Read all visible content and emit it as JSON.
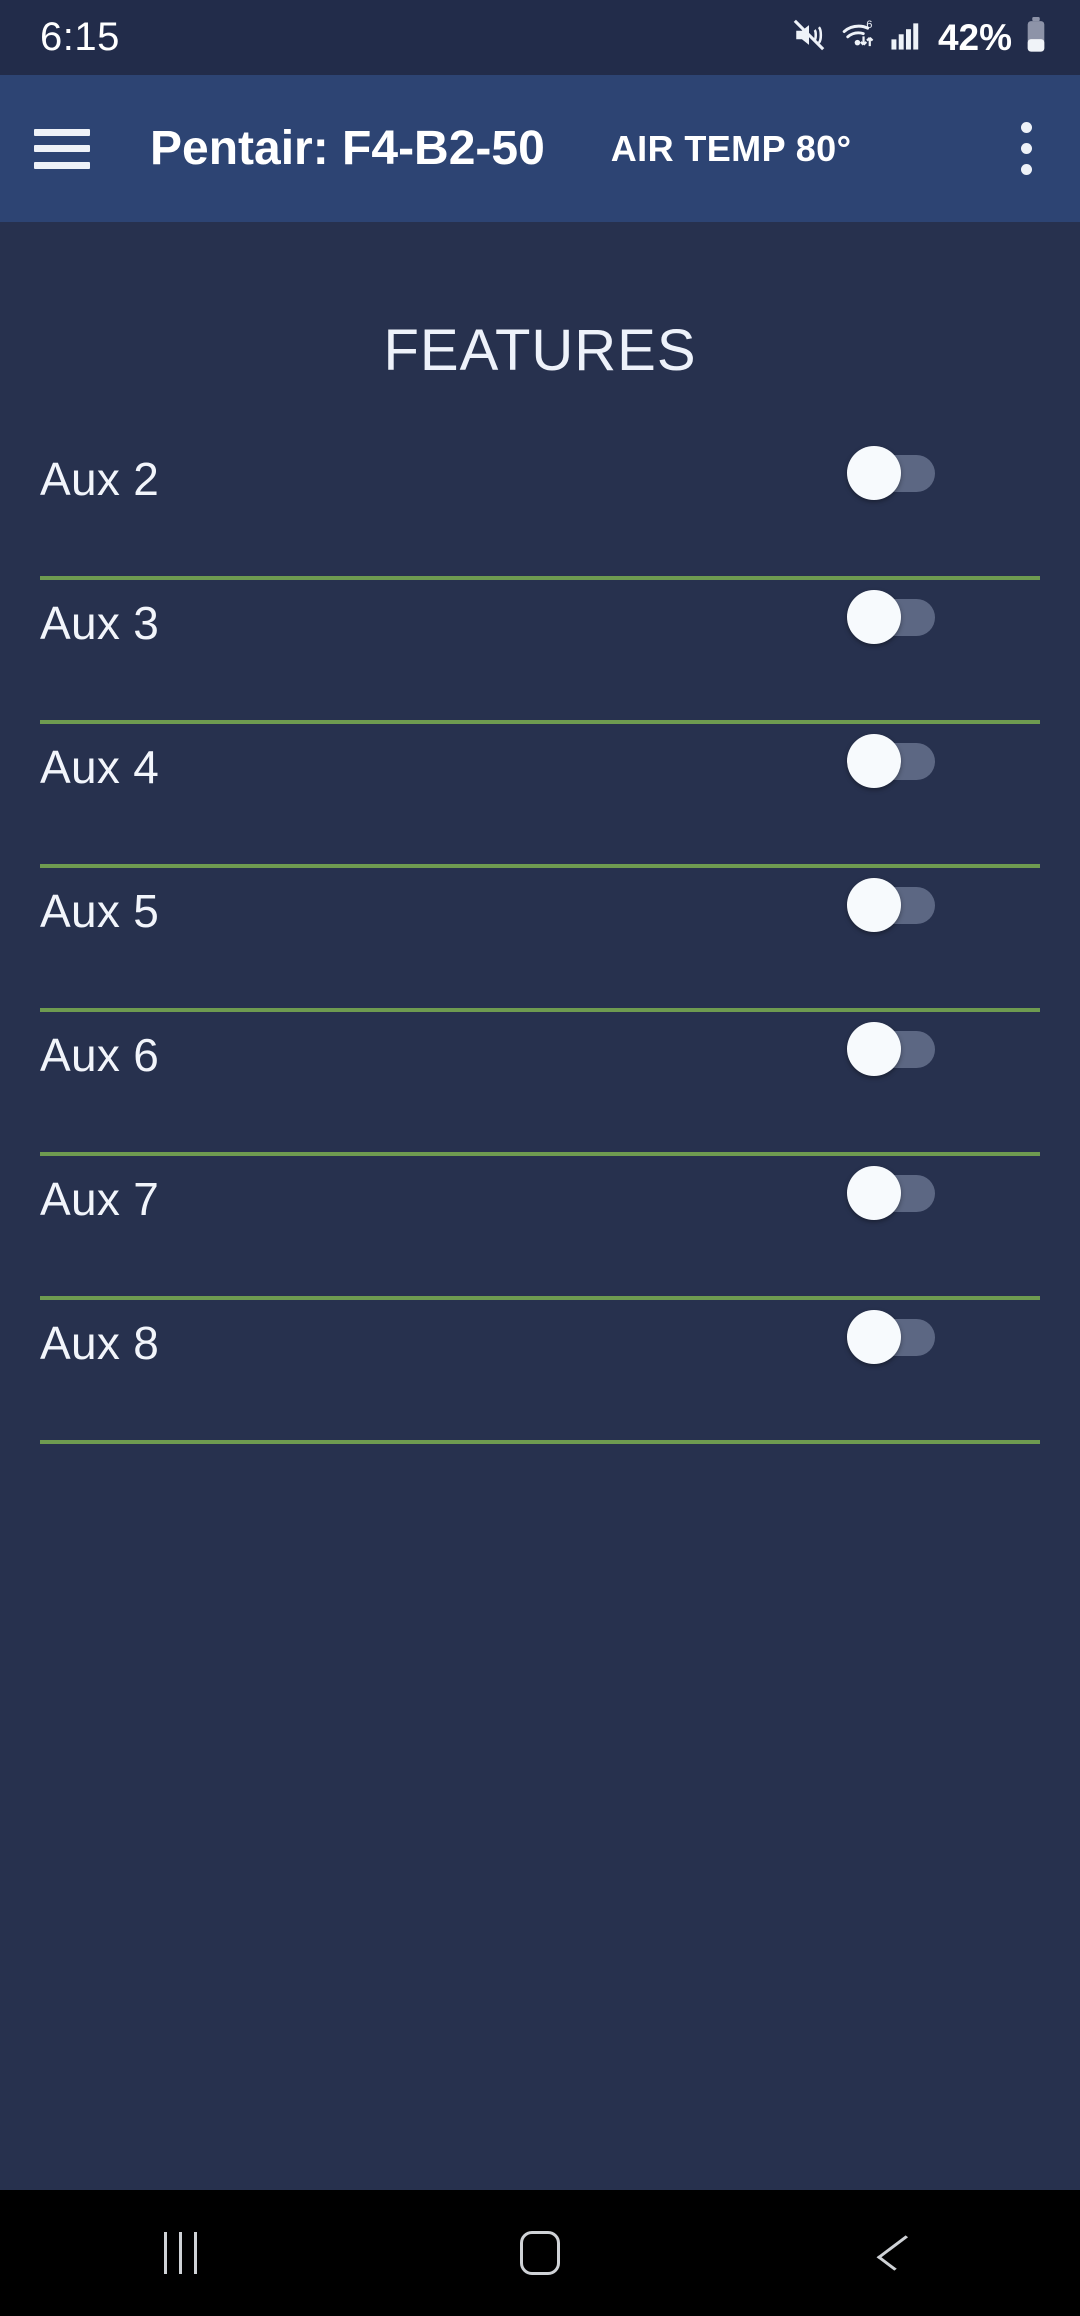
{
  "status_bar": {
    "time": "6:15",
    "battery_percent": "42%",
    "icons": [
      "mute-icon",
      "wifi-icon",
      "cellular-signal-icon",
      "battery-icon"
    ]
  },
  "app_bar": {
    "menu_icon": "hamburger-menu-icon",
    "title": "Pentair: F4-B2-50",
    "air_temp": "AIR TEMP 80°",
    "overflow_icon": "more-vertical-icon"
  },
  "main": {
    "section_title": "FEATURES",
    "features": [
      {
        "label": "Aux 2",
        "state": "off"
      },
      {
        "label": "Aux 3",
        "state": "off"
      },
      {
        "label": "Aux 4",
        "state": "off"
      },
      {
        "label": "Aux 5",
        "state": "off"
      },
      {
        "label": "Aux 6",
        "state": "off"
      },
      {
        "label": "Aux 7",
        "state": "off"
      },
      {
        "label": "Aux 8",
        "state": "off"
      }
    ]
  },
  "nav_bar": {
    "recents_label": "recents-icon",
    "home_label": "home-icon",
    "back_label": "back-icon"
  },
  "colors": {
    "status_bar_bg": "#222c4a",
    "app_bar_bg": "#2d4473",
    "content_bg": "#27314e",
    "divider_green": "#6e9b50",
    "toggle_track_off": "#5c6783",
    "toggle_thumb": "#f7fafd",
    "nav_bar_bg": "#000000",
    "text_primary": "#f2f5fb"
  }
}
